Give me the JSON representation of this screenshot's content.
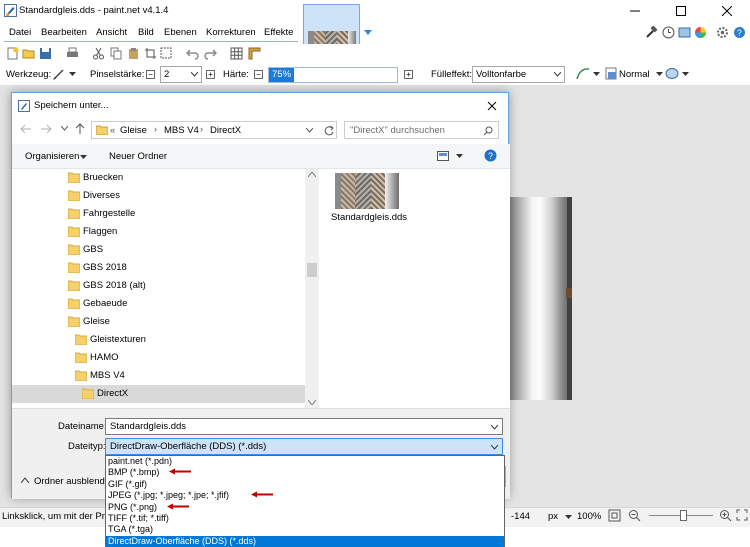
{
  "app": {
    "title": "Standardgleis.dds - paint.net v4.1.4",
    "menus": [
      "Datei",
      "Bearbeiten",
      "Ansicht",
      "Bild",
      "Ebenen",
      "Korrekturen",
      "Effekte"
    ],
    "status_text": "Linksklick, um mit der Prim",
    "coord_readout": "-144",
    "unit": "px",
    "zoom": "100%"
  },
  "toolbar": {
    "tool_label": "Werkzeug:",
    "brush_label": "Pinselstärke:",
    "brush_value": "2",
    "hardness_label": "Härte:",
    "hardness_value": "75%",
    "hardness_fraction": 0.75,
    "fill_label": "Fülleffekt:",
    "fill_value": "Volltonfarbe",
    "blend_value": "Normal"
  },
  "dialog": {
    "title": "Speichern unter...",
    "breadcrumb": [
      "Gleise",
      "MBS V4",
      "DirectX"
    ],
    "search_placeholder": "\"DirectX\" durchsuchen",
    "organize_label": "Organisieren",
    "new_folder_label": "Neuer Ordner",
    "tree": [
      {
        "label": "Bruecken",
        "indent": 0
      },
      {
        "label": "Diverses",
        "indent": 0
      },
      {
        "label": "Fahrgestelle",
        "indent": 0
      },
      {
        "label": "Flaggen",
        "indent": 0
      },
      {
        "label": "GBS",
        "indent": 0
      },
      {
        "label": "GBS 2018",
        "indent": 0
      },
      {
        "label": "GBS 2018 (alt)",
        "indent": 0
      },
      {
        "label": "Gebaeude",
        "indent": 0
      },
      {
        "label": "Gleise",
        "indent": 0
      },
      {
        "label": "Gleistexturen",
        "indent": 1
      },
      {
        "label": "HAMO",
        "indent": 1
      },
      {
        "label": "MBS V4",
        "indent": 1
      },
      {
        "label": "DirectX",
        "indent": 2,
        "selected": true
      }
    ],
    "file_item_label": "Standardgleis.dds",
    "filename_label": "Dateiname:",
    "filename_value": "Standardgleis.dds",
    "filetype_label": "Dateityp:",
    "filetype_value": "DirectDraw-Oberfläche (DDS) (*.dds)",
    "hide_folders_label": "Ordner ausblende"
  },
  "filetype_options": [
    {
      "label": "paint.net (*.pdn)"
    },
    {
      "label": "BMP (*.bmp)",
      "arrow": true
    },
    {
      "label": "GIF (*.gif)"
    },
    {
      "label": "JPEG (*.jpg; *.jpeg; *.jpe; *.jfif)",
      "arrow": true
    },
    {
      "label": "PNG (*.png)",
      "arrow": true
    },
    {
      "label": "TIFF (*.tif; *.tiff)"
    },
    {
      "label": "TGA (*.tga)"
    },
    {
      "label": "DirectDraw-Oberfläche (DDS) (*.dds)",
      "selected": true
    }
  ],
  "colors": {
    "accent": "#0078d7",
    "folder": "#f6d06b",
    "arrow": "#c00000"
  }
}
